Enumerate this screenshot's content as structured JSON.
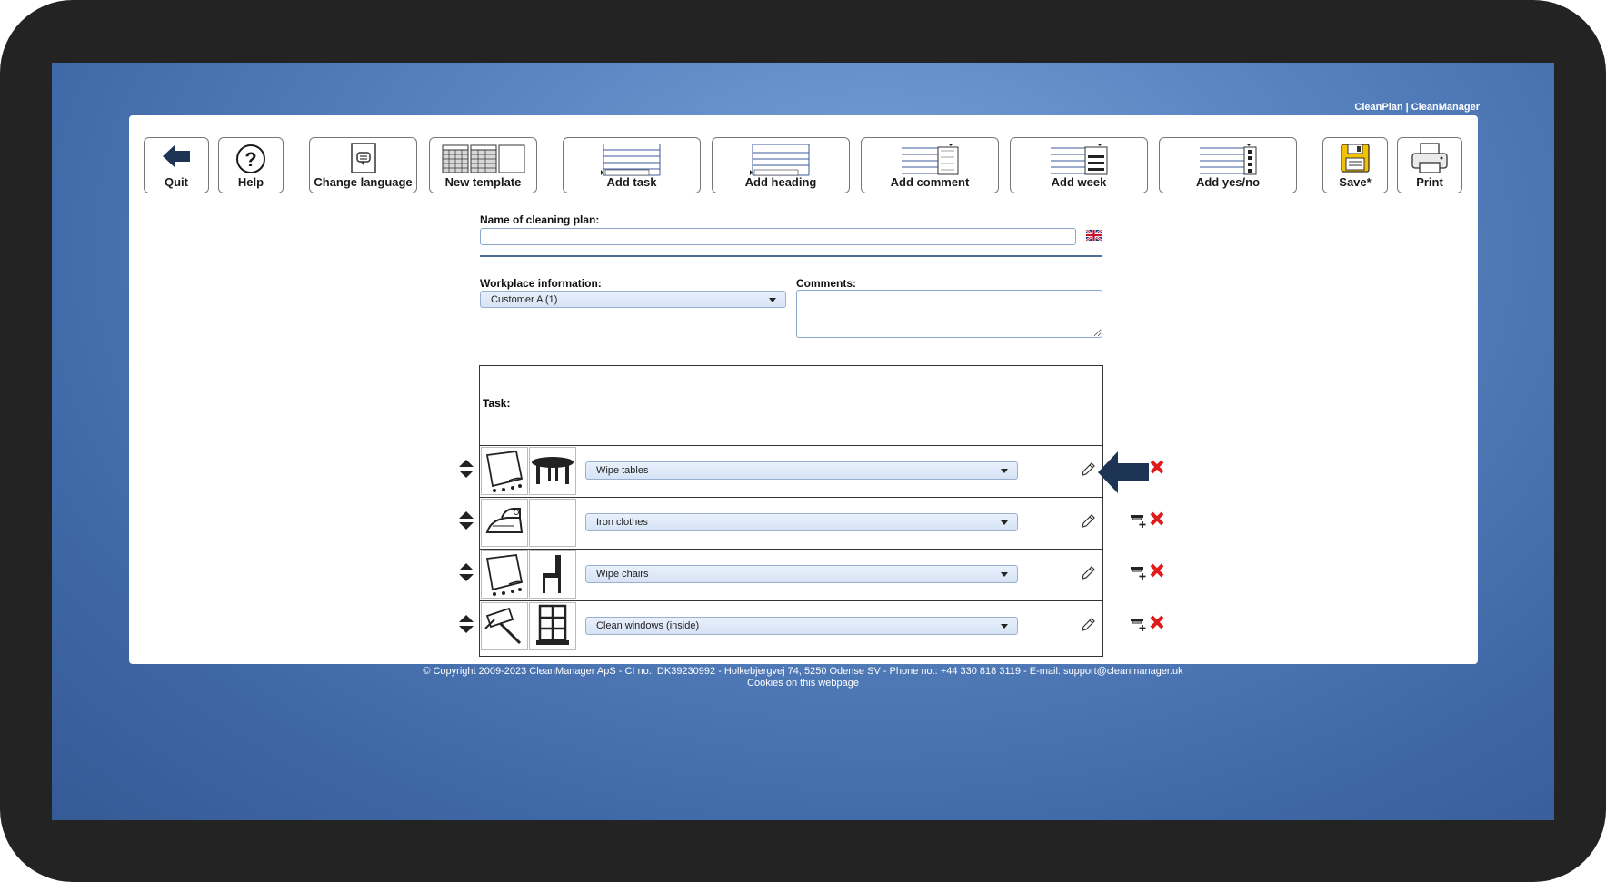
{
  "brand": "CleanPlan | CleanManager",
  "toolbar": {
    "quit": "Quit",
    "help": "Help",
    "change_language": "Change language",
    "new_template": "New template",
    "add_task": "Add task",
    "add_heading": "Add heading",
    "add_comment": "Add comment",
    "add_week": "Add week",
    "add_yesno": "Add yes/no",
    "save": "Save*",
    "print": "Print"
  },
  "form": {
    "name_label": "Name of cleaning plan:",
    "name_value": "",
    "workplace_label": "Workplace information:",
    "workplace_value": "Customer A (1)",
    "comments_label": "Comments:",
    "comments_value": ""
  },
  "tasks": {
    "header": "Task:",
    "rows": [
      {
        "label": "Wipe tables"
      },
      {
        "label": "Iron clothes"
      },
      {
        "label": "Wipe chairs"
      },
      {
        "label": "Clean windows (inside)"
      }
    ]
  },
  "footer": {
    "copyright": "© Copyright 2009-2023 CleanManager ApS - CI no.: DK39230992 - Holkebjergvej 74, 5250 Odense SV - Phone no.: +44 330 818 3119 - E-mail: support@cleanmanager.uk",
    "cookies": "Cookies on this webpage"
  },
  "colors": {
    "accent": "#1e3455",
    "delete": "#e01b1b",
    "save_yellow": "#f2c200"
  }
}
